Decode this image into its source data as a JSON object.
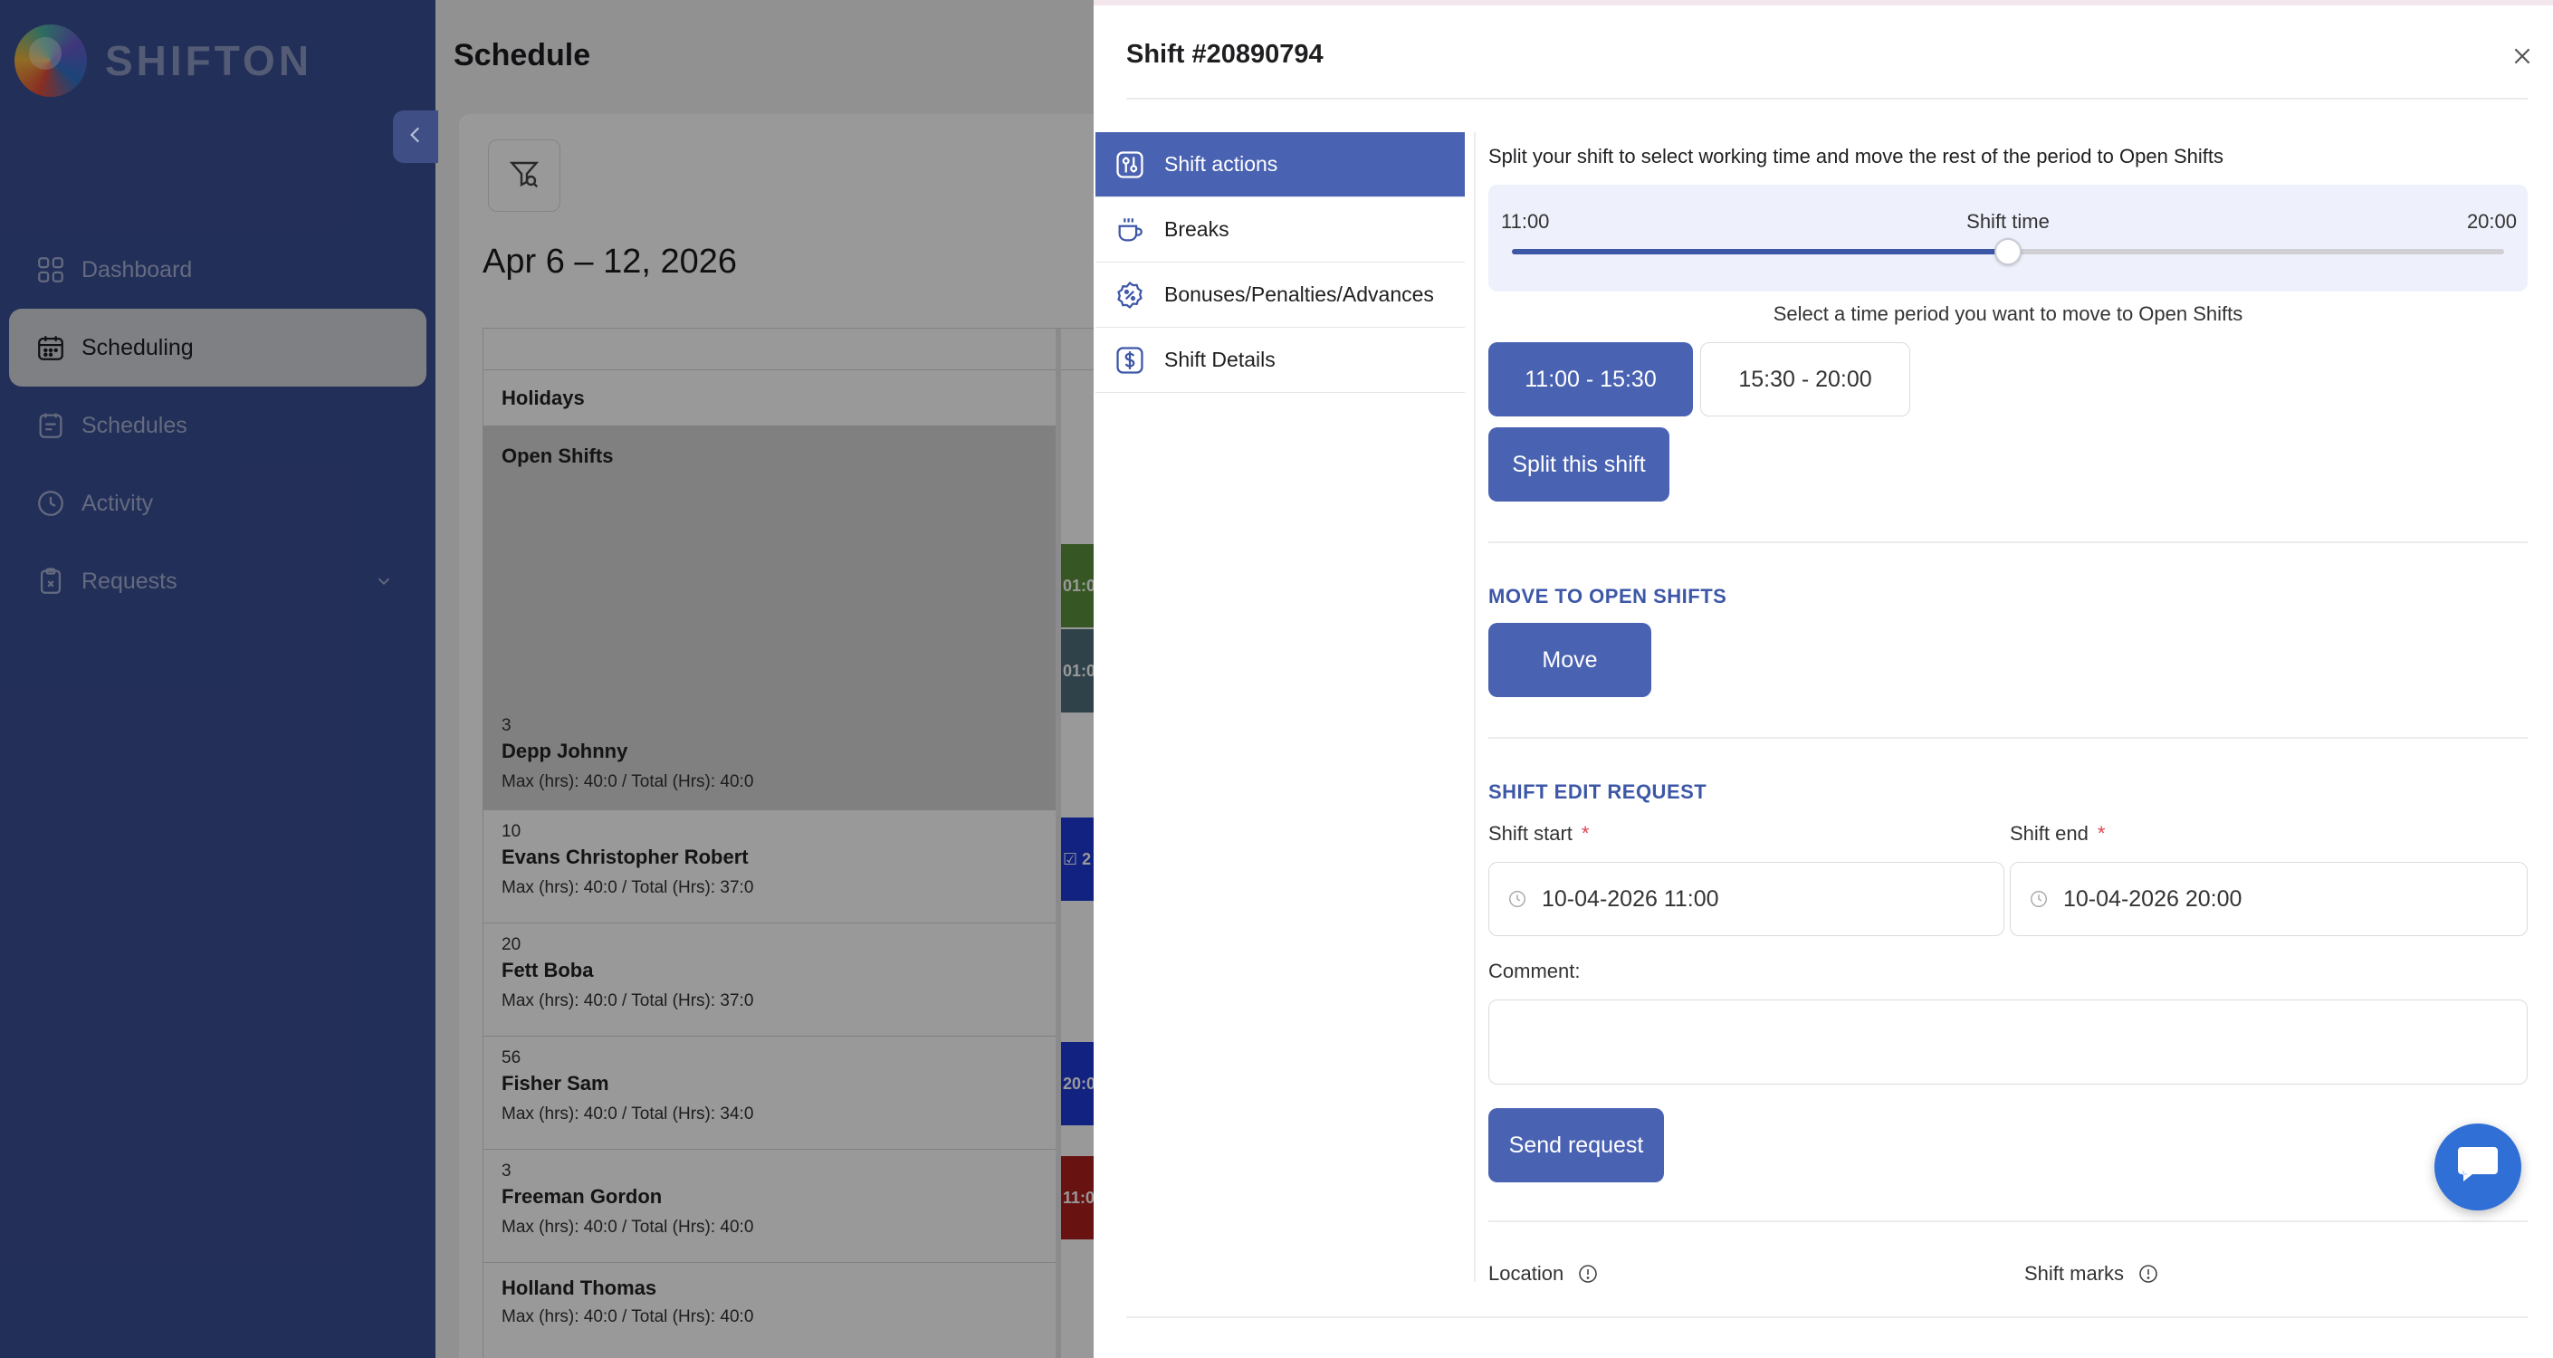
{
  "brand": {
    "name": "SHIFTON"
  },
  "sidebar": {
    "items": [
      {
        "label": "Dashboard",
        "icon": "dashboard-grid-icon",
        "active": false
      },
      {
        "label": "Scheduling",
        "icon": "calendar-icon",
        "active": true
      },
      {
        "label": "Schedules",
        "icon": "schedule-list-icon",
        "active": false
      },
      {
        "label": "Activity",
        "icon": "clock-icon",
        "active": false
      },
      {
        "label": "Requests",
        "icon": "clipboard-icon",
        "active": false,
        "expandable": true
      }
    ]
  },
  "main": {
    "title": "Schedule",
    "date_range": "Apr 6 – 12, 2026",
    "holidays_label": "Holidays",
    "open_shifts_label": "Open Shifts",
    "employees": [
      {
        "count": "3",
        "name": "Depp Johnny",
        "hours": "Max (hrs): 40:0 / Total (Hrs): 40:0"
      },
      {
        "count": "10",
        "name": "Evans Christopher Robert",
        "hours": "Max (hrs): 40:0 / Total (Hrs): 37:0"
      },
      {
        "count": "20",
        "name": "Fett Boba",
        "hours": "Max (hrs): 40:0 / Total (Hrs): 37:0"
      },
      {
        "count": "56",
        "name": "Fisher Sam",
        "hours": "Max (hrs): 40:0 / Total (Hrs): 34:0"
      },
      {
        "count": "3",
        "name": "Freeman Gordon",
        "hours": "Max (hrs): 40:0 / Total (Hrs): 40:0"
      },
      {
        "count": "",
        "name": "Holland Thomas",
        "hours": "Max (hrs): 40:0 / Total (Hrs): 40:0"
      }
    ],
    "chips": [
      {
        "text": "01:0",
        "color": "#5a8f3d"
      },
      {
        "text": "01:0",
        "color": "#4f6d7a"
      },
      {
        "text": "☑ 2",
        "color": "#1f3ad6"
      },
      {
        "text": "20:0",
        "color": "#1f3ad6"
      },
      {
        "text": "11:0",
        "color": "#b01e1e"
      }
    ]
  },
  "drawer": {
    "title": "Shift #20890794",
    "tabs": [
      {
        "label": "Shift actions",
        "icon": "sliders-icon",
        "active": true
      },
      {
        "label": "Breaks",
        "icon": "coffee-cup-icon",
        "active": false
      },
      {
        "label": "Bonuses/Penalties/Advances",
        "icon": "percent-badge-icon",
        "active": false
      },
      {
        "label": "Shift Details",
        "icon": "dollar-icon",
        "active": false
      }
    ],
    "split": {
      "description": "Split your shift to select working time and move the rest of the period to Open Shifts",
      "slider_start": "11:00",
      "slider_label": "Shift time",
      "slider_end": "20:00",
      "slider_fraction": 0.5,
      "select_description": "Select a time period you want to move to Open Shifts",
      "period_selected": "11:00 - 15:30",
      "period_other": "15:30 - 20:00",
      "split_button": "Split this shift"
    },
    "move": {
      "title": "MOVE TO OPEN SHIFTS",
      "button": "Move"
    },
    "edit_request": {
      "title": "SHIFT EDIT REQUEST",
      "start_label": "Shift start",
      "end_label": "Shift end",
      "required_mark": "*",
      "start_value": "10-04-2026 11:00",
      "end_value": "10-04-2026 20:00",
      "comment_label": "Comment:",
      "comment_value": "",
      "send_button": "Send request"
    },
    "location_label": "Location",
    "shift_marks_label": "Shift marks"
  },
  "colors": {
    "sidebar_bg": "#3a4f93",
    "accent": "#4a62b2",
    "section_title": "#3d57a7",
    "required": "#e0434f",
    "chat_fab": "#2f6fd6"
  }
}
